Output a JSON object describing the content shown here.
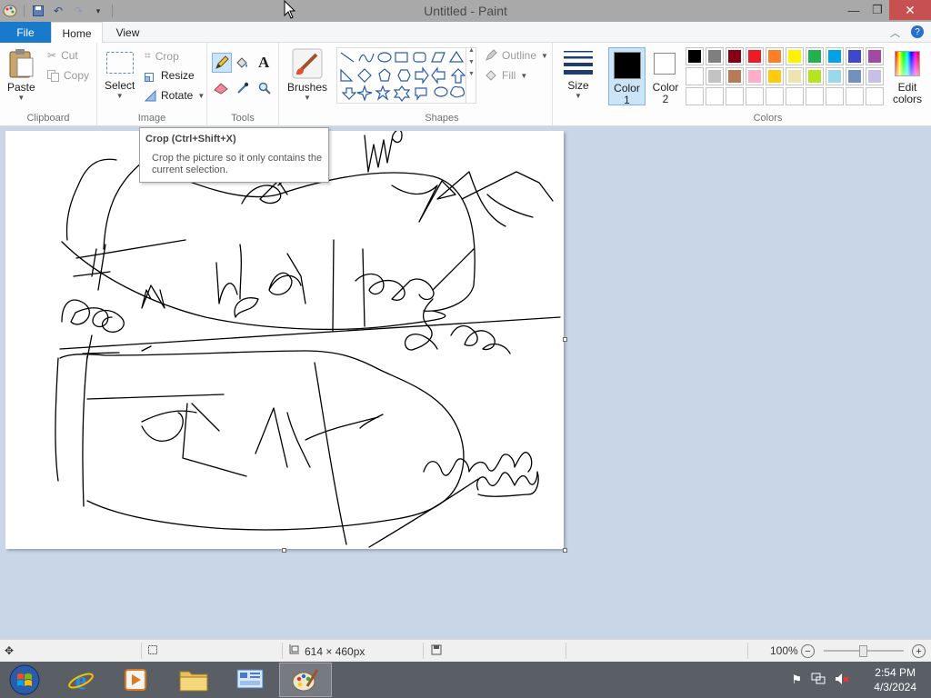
{
  "window": {
    "title": "Untitled - Paint",
    "minimize_icon": "minimize-icon",
    "maximize_icon": "restore-icon",
    "close_icon": "close-icon"
  },
  "tabs": {
    "file": "File",
    "home": "Home",
    "view": "View"
  },
  "ribbon": {
    "clipboard": {
      "label": "Clipboard",
      "paste": "Paste",
      "cut": "Cut",
      "copy": "Copy"
    },
    "image": {
      "label": "Image",
      "select": "Select",
      "crop": "Crop",
      "resize": "Resize",
      "rotate": "Rotate"
    },
    "tools": {
      "label": "Tools"
    },
    "brushes": {
      "label": "Brushes"
    },
    "shapes": {
      "label": "Shapes",
      "outline": "Outline",
      "fill": "Fill"
    },
    "size": {
      "label": "Size"
    },
    "colors": {
      "label": "Colors",
      "color1": "Color 1",
      "color1_line1": "Color",
      "color1_line2": "1",
      "color2_line1": "Color",
      "color2_line2": "2",
      "edit_line1": "Edit",
      "edit_line2": "colors",
      "color1_value": "#000000",
      "color2_value": "#ffffff",
      "palette": [
        "#000000",
        "#7f7f7f",
        "#880015",
        "#ed1c24",
        "#ff7f27",
        "#fff200",
        "#22b14c",
        "#00a2e8",
        "#3f48cc",
        "#a349a4",
        "#ffffff",
        "#c3c3c3",
        "#b97a57",
        "#ffaec9",
        "#ffc90e",
        "#efe4b0",
        "#b5e61d",
        "#99d9ea",
        "#7092be",
        "#c8bfe7",
        "",
        "",
        "",
        "",
        "",
        "",
        "",
        "",
        "",
        ""
      ]
    }
  },
  "tooltip": {
    "title": "Crop (Ctrl+Shift+X)",
    "body": "Crop the picture so it only contains the current selection."
  },
  "statusbar": {
    "image_size": "614 × 460px",
    "zoom": "100%",
    "zoom_fraction": 0.5
  },
  "taskbar": {
    "time": "2:54 PM",
    "date": "4/3/2024"
  }
}
